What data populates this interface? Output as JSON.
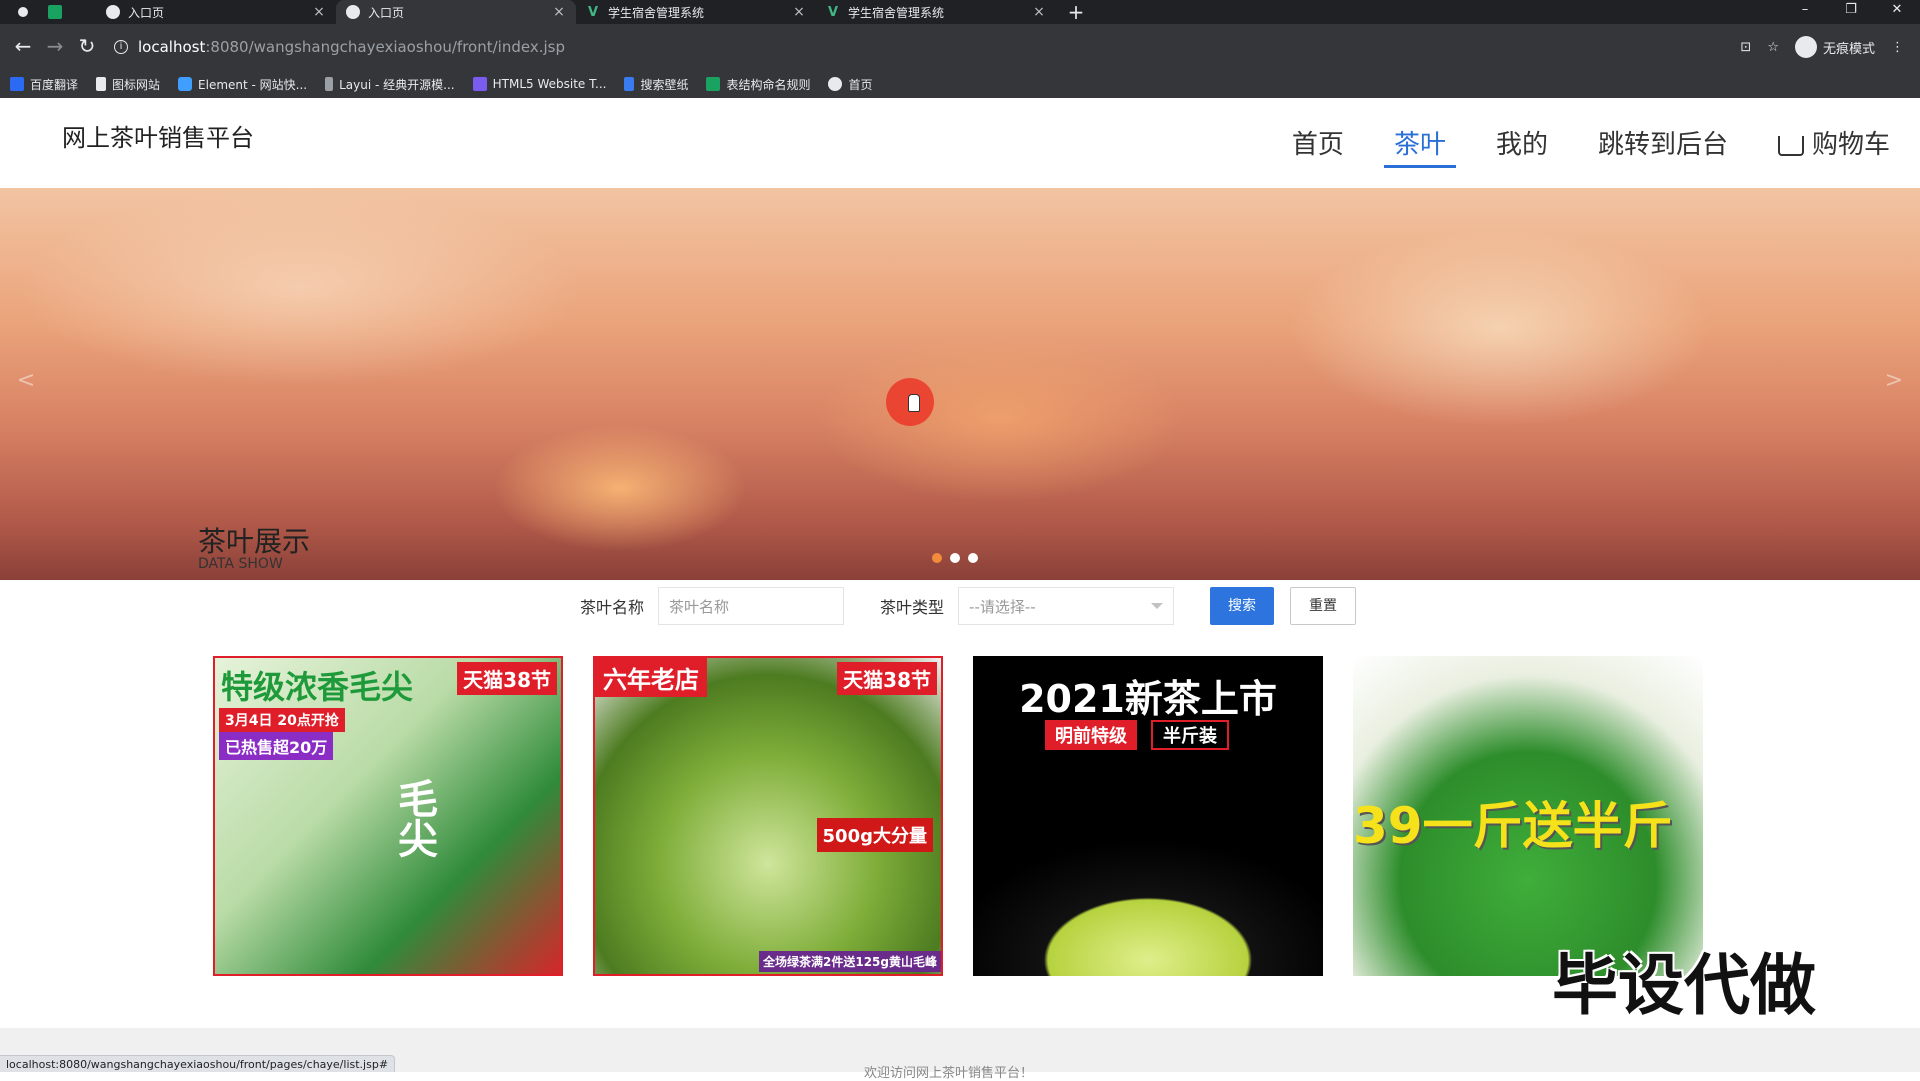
{
  "browser": {
    "tabs": [
      {
        "title": "入口页",
        "icon": "globe-icon",
        "active": false
      },
      {
        "title": "入口页",
        "icon": "globe-icon",
        "active": true
      },
      {
        "title": "学生宿舍管理系统",
        "icon": "vue-icon",
        "active": false
      },
      {
        "title": "学生宿舍管理系统",
        "icon": "vue-icon",
        "active": false
      }
    ],
    "new_tab": "+",
    "url_host": "localhost",
    "url_path": ":8080/wangshangchayexiaoshou/front/index.jsp",
    "profile": "无痕模式",
    "bookmarks": [
      "百度翻译",
      "图标网站",
      "Element - 网站快...",
      "Layui - 经典开源模...",
      "HTML5 Website T...",
      "搜索壁纸",
      "表结构命名规则",
      "首页"
    ],
    "status_url": "localhost:8080/wangshangchayexiaoshou/front/pages/chaye/list.jsp#"
  },
  "site": {
    "title": "网上茶叶销售平台",
    "nav": [
      {
        "label": "首页",
        "active": false
      },
      {
        "label": "茶叶",
        "active": true
      },
      {
        "label": "我的",
        "active": false
      },
      {
        "label": "跳转到后台",
        "active": false
      },
      {
        "label": "购物车",
        "active": false
      }
    ]
  },
  "banner": {
    "prev": "<",
    "next": ">",
    "dots": 3,
    "active_dot": 0
  },
  "section": {
    "title": "茶叶展示",
    "subtitle": "DATA SHOW"
  },
  "search": {
    "name_label": "茶叶名称",
    "name_placeholder": "茶叶名称",
    "type_label": "茶叶类型",
    "type_selected": "--请选择--",
    "search_button": "搜索",
    "reset_button": "重置"
  },
  "products": [
    {
      "texts": [
        "特级浓香毛尖",
        "天猫38节",
        "3月4日 20点开抢",
        "已热售超20万",
        "毛尖"
      ]
    },
    {
      "texts": [
        "六年老店",
        "天猫38节",
        "500g大分量",
        "全场绿茶满2件送125g黄山毛峰"
      ]
    },
    {
      "texts": [
        "2021新茶上市",
        "明前特级",
        "半斤装"
      ]
    },
    {
      "texts": [
        "39一斤送半斤"
      ]
    }
  ],
  "watermark": "毕设代做",
  "footer": "欢迎访问网上茶叶销售平台！"
}
